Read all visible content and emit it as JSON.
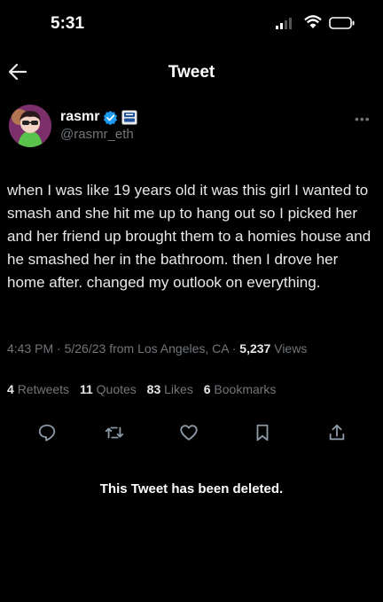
{
  "status_bar": {
    "time": "5:31"
  },
  "header": {
    "title": "Tweet"
  },
  "author": {
    "name": "rasmr",
    "handle": "@rasmr_eth"
  },
  "tweet": {
    "text": "when I was like 19 years old it was this girl I wanted to smash and she hit me up to hang out so I picked her and her friend up brought them to a homies house and he smashed her in the bathroom. then I drove her home after. changed my outlook on everything.",
    "time": "4:43 PM",
    "date": "5/26/23",
    "source": "from Los Angeles, CA",
    "views_count": "5,237",
    "views_label": "Views"
  },
  "stats": {
    "retweets_count": "4",
    "retweets_label": "Retweets",
    "quotes_count": "11",
    "quotes_label": "Quotes",
    "likes_count": "83",
    "likes_label": "Likes",
    "bookmarks_count": "6",
    "bookmarks_label": "Bookmarks"
  },
  "actions": [
    "reply-icon",
    "retweet-icon",
    "like-icon",
    "bookmark-icon",
    "share-icon"
  ],
  "notice": {
    "deleted": "This Tweet has been deleted."
  },
  "colors": {
    "background": "#000000",
    "text": "#e7e9ea",
    "secondary": "#71767b",
    "verified": "#1d9bf0"
  }
}
